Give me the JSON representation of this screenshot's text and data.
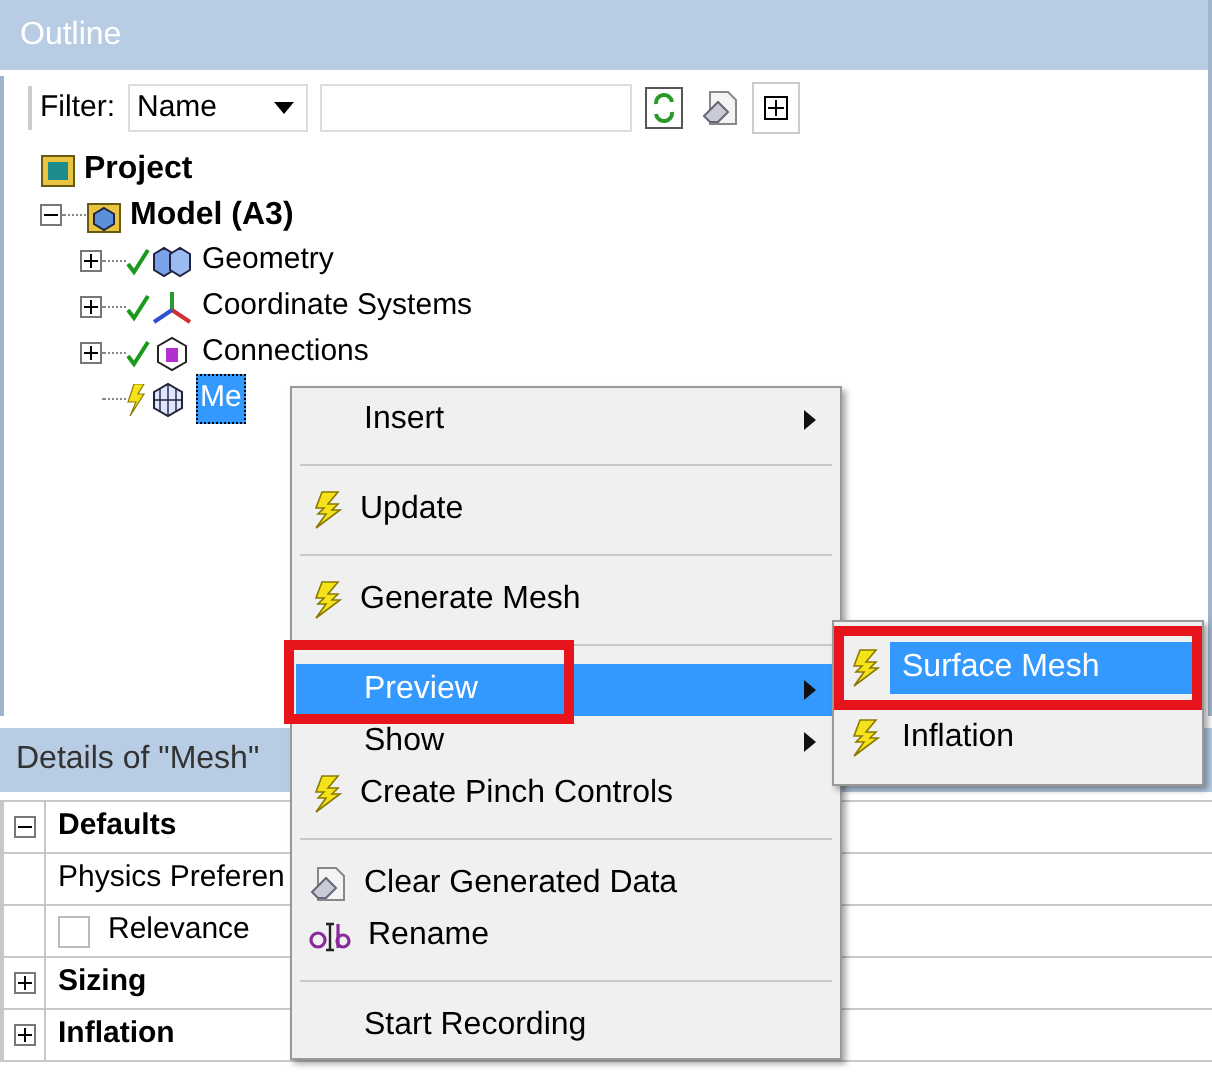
{
  "outline": {
    "title": "Outline",
    "filter": {
      "label": "Filter:",
      "value": "Name"
    },
    "tree": [
      {
        "label": "Project",
        "children": [
          {
            "label": "Model (A3)",
            "expanded": true,
            "children": [
              {
                "label": "Geometry",
                "expanded": false,
                "selected": false
              },
              {
                "label": "Coordinate Systems",
                "expanded": false,
                "selected": false
              },
              {
                "label": "Connections",
                "expanded": false,
                "selected": false
              },
              {
                "label": "Me",
                "selected": true
              }
            ]
          }
        ]
      }
    ]
  },
  "details": {
    "title": "Details of \"Mesh\"",
    "rows": [
      {
        "kind": "group",
        "label": "Defaults",
        "expanded": true
      },
      {
        "kind": "property",
        "label": "Physics Preferen"
      },
      {
        "kind": "check",
        "label": "Relevance",
        "checked": false
      },
      {
        "kind": "group",
        "label": "Sizing",
        "expanded": false
      },
      {
        "kind": "group",
        "label": "Inflation",
        "expanded": false
      }
    ]
  },
  "context_menu": {
    "items": [
      {
        "kind": "item",
        "label": "Insert",
        "submenu": true,
        "selected": false,
        "marked": false
      },
      {
        "kind": "separator"
      },
      {
        "kind": "item",
        "label": "Update",
        "submenu": false,
        "selected": false,
        "marked": false
      },
      {
        "kind": "separator"
      },
      {
        "kind": "item",
        "label": "Generate Mesh",
        "submenu": false,
        "selected": false,
        "marked": false
      },
      {
        "kind": "separator"
      },
      {
        "kind": "item",
        "label": "Preview",
        "submenu": true,
        "selected": true,
        "marked": true
      },
      {
        "kind": "item",
        "label": "Show",
        "submenu": true,
        "selected": false,
        "marked": false
      },
      {
        "kind": "item",
        "label": "Create Pinch Controls",
        "submenu": false,
        "selected": false,
        "marked": false
      },
      {
        "kind": "separator"
      },
      {
        "kind": "item",
        "label": "Clear Generated Data",
        "submenu": false,
        "selected": false,
        "marked": false
      },
      {
        "kind": "item",
        "label": "Rename",
        "submenu": false,
        "selected": false,
        "marked": false
      },
      {
        "kind": "separator"
      },
      {
        "kind": "item",
        "label": "Start Recording",
        "submenu": false,
        "selected": false,
        "marked": false
      }
    ]
  },
  "submenu": {
    "items": [
      {
        "label": "Surface Mesh",
        "selected": true,
        "marked": true
      },
      {
        "label": "Inflation",
        "selected": false,
        "marked": false
      }
    ]
  }
}
